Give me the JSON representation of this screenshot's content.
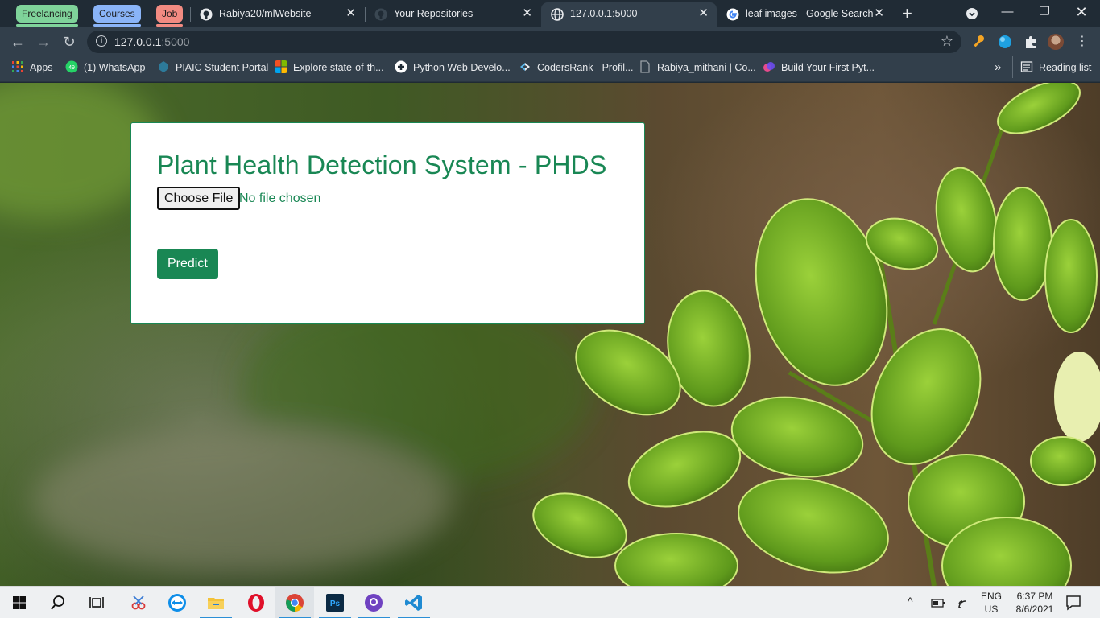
{
  "tab_groups": [
    "Freelancing",
    "Courses",
    "Job"
  ],
  "tabs": [
    {
      "title": "Rabiya20/mlWebsite",
      "icon": "github-icon"
    },
    {
      "title": "Your Repositories",
      "icon": "github-icon"
    },
    {
      "title": "127.0.0.1:5000",
      "icon": "globe-icon",
      "active": true
    },
    {
      "title": "leaf images - Google Search",
      "icon": "google-icon"
    }
  ],
  "address": {
    "host": "127.0.0.1",
    "port": ":5000"
  },
  "bookmarks": [
    {
      "label": "Apps",
      "icon": "apps-grid-icon"
    },
    {
      "label": "(1) WhatsApp",
      "icon": "whatsapp-icon",
      "badge": "49"
    },
    {
      "label": "PIAIC Student Portal",
      "icon": "piaic-icon"
    },
    {
      "label": "Explore state-of-th...",
      "icon": "microsoft-icon"
    },
    {
      "label": "Python Web Develo...",
      "icon": "python-icon"
    },
    {
      "label": "CodersRank - Profil...",
      "icon": "codersrank-icon"
    },
    {
      "label": "Rabiya_mithani | Co...",
      "icon": "page-icon"
    },
    {
      "label": "Build Your First Pyt...",
      "icon": "course-icon"
    }
  ],
  "reading_list": "Reading list",
  "overflow": "»",
  "page": {
    "title": "Plant Health Detection System - PHDS",
    "file_button": "Choose File",
    "file_status": "No file chosen",
    "submit": "Predict"
  },
  "tray": {
    "lang_top": "ENG",
    "lang_bottom": "US",
    "time": "6:37 PM",
    "date": "8/6/2021"
  },
  "colors": {
    "accent": "#198754",
    "tab_bg": "#202b35",
    "toolbar_bg": "#323f4b"
  }
}
